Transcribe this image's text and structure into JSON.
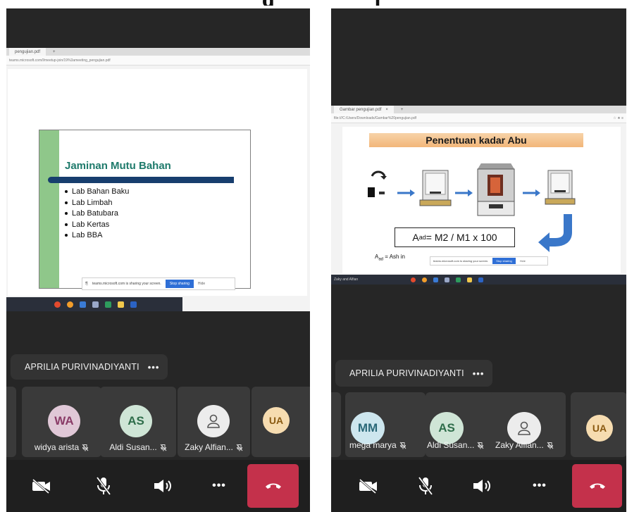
{
  "heading": {
    "left_fragment": "g",
    "right_fragment": "j"
  },
  "left": {
    "tab_title": "pengujian.pdf",
    "address": "teams.microsoft.com/l/meetup-join/19%3ameeting_pengujian.pdf",
    "slide": {
      "title": "Jaminan Mutu Bahan",
      "items": [
        "Lab Bahan Baku",
        "Lab Limbah",
        "Lab Batubara",
        "Lab Kertas",
        "Lab BBA"
      ]
    },
    "share_bar": {
      "message": "teams.microsoft.com is sharing your screen.",
      "stop": "Stop sharing",
      "hide": "Hide"
    },
    "presenter": "APRILIA PURIVINADIYANTI",
    "participants": [
      {
        "initials": "",
        "name": "",
        "color": "#3a3a3a"
      },
      {
        "initials": "WA",
        "name": "widya arista",
        "color": "#e0c8d7"
      },
      {
        "initials": "AS",
        "name": "Aldi Susan...",
        "color": "#cfe5d6"
      },
      {
        "initials": "",
        "name": "Zaky Alfian...",
        "color": "#ececec"
      },
      {
        "initials": "UA",
        "name": "",
        "color": "#f6dcb0"
      }
    ]
  },
  "right": {
    "tab_title": "Gambar pengujian.pdf",
    "address": "file:///C:/Users/Downloads/Gambar%20pengujian.pdf",
    "slide": {
      "title": "Penentuan kadar Abu",
      "formula": "A",
      "formula_sub": "ad",
      "formula_rest": " = M2 / M1 x 100",
      "ash_prefix": "A",
      "ash_sub": "ad",
      "ash_rest": " = Ash in"
    },
    "taskbar_left_text": "Zaky and Alfian",
    "share_bar": {
      "message": "teams.microsoft.com is sharing your screen.",
      "stop": "Stop sharing",
      "hide": "Hide"
    },
    "presenter": "APRILIA PURIVINADIYANTI",
    "participants": [
      {
        "initials": "",
        "name": "",
        "color": "#3a3a3a"
      },
      {
        "initials": "MM",
        "name": "mega marya",
        "color": "#cde6ee"
      },
      {
        "initials": "AS",
        "name": "Aldi Susan...",
        "color": "#cfe5d6"
      },
      {
        "initials": "",
        "name": "Zaky Alfian...",
        "color": "#ececec"
      },
      {
        "initials": "UA",
        "name": "",
        "color": "#f6dcb0"
      }
    ]
  },
  "more_dots": "•••",
  "colors": {
    "hangup": "#c4314b",
    "background": "#262626",
    "green_panel": "#8fc78a",
    "title_teal": "#1e7a6b"
  }
}
